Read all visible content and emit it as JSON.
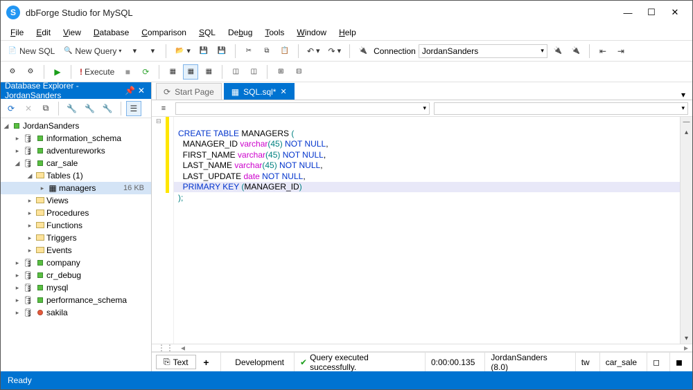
{
  "app": {
    "title": "dbForge Studio for MySQL",
    "logo_letter": "S"
  },
  "window_controls": {
    "min": "—",
    "max": "☐",
    "close": "✕"
  },
  "menu": [
    "File",
    "Edit",
    "View",
    "Database",
    "Comparison",
    "SQL",
    "Debug",
    "Tools",
    "Window",
    "Help"
  ],
  "toolbar1": {
    "new_sql": "New SQL",
    "new_query": "New Query",
    "connection_label": "Connection",
    "connection_value": "JordanSanders"
  },
  "toolbar2": {
    "execute": "Execute"
  },
  "explorer": {
    "title": "Database Explorer - JordanSanders",
    "root": "JordanSanders",
    "schemas": [
      {
        "name": "information_schema",
        "status": "green"
      },
      {
        "name": "adventureworks",
        "status": "green"
      },
      {
        "name": "car_sale",
        "status": "green",
        "expanded": true,
        "children": [
          {
            "type": "folder",
            "name": "Tables (1)",
            "expanded": true,
            "tables": [
              {
                "name": "managers",
                "size": "16 KB",
                "selected": true
              }
            ]
          },
          {
            "type": "folder",
            "name": "Views"
          },
          {
            "type": "folder",
            "name": "Procedures"
          },
          {
            "type": "folder",
            "name": "Functions"
          },
          {
            "type": "folder",
            "name": "Triggers"
          },
          {
            "type": "folder",
            "name": "Events"
          }
        ]
      },
      {
        "name": "company",
        "status": "green"
      },
      {
        "name": "cr_debug",
        "status": "green"
      },
      {
        "name": "mysql",
        "status": "green"
      },
      {
        "name": "performance_schema",
        "status": "green"
      },
      {
        "name": "sakila",
        "status": "red"
      }
    ]
  },
  "tabs": {
    "start": "Start Page",
    "sql": "SQL.sql*"
  },
  "sql": {
    "l1_a": "CREATE TABLE",
    "l1_b": " MANAGERS ",
    "l2_a": "  MANAGER_ID ",
    "l2_b": "varchar",
    "l2_c": "(45)",
    "l2_d": " NOT NULL",
    "l2_e": ",",
    "l3_a": "  FIRST_NAME ",
    "l3_b": "varchar",
    "l3_c": "(45)",
    "l3_d": " NOT NULL",
    "l3_e": ",",
    "l4_a": "  LAST_NAME ",
    "l4_b": "varchar",
    "l4_c": "(45)",
    "l4_d": " NOT NULL",
    "l4_e": ",",
    "l5_a": "  LAST_UPDATE ",
    "l5_b": "date",
    "l5_c": " NOT NULL",
    "l5_d": ",",
    "l6_a": "  PRIMARY KEY ",
    "l6_b": "(",
    "l6_c": "MANAGER_ID",
    "l6_d": ")",
    "l7": ");"
  },
  "status": {
    "text_tab": "Text",
    "environment": "Development",
    "message": "Query executed successfully.",
    "time": "0:00:00.135",
    "connection": "JordanSanders (8.0)",
    "user": "tw",
    "database": "car_sale"
  },
  "footer": {
    "ready": "Ready"
  }
}
